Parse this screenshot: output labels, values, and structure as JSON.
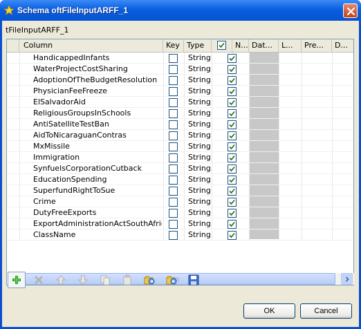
{
  "window": {
    "title": "Schema oftFileInputARFF_1",
    "icon": "star-icon",
    "close_icon": "close-icon"
  },
  "schema_label": "tFileInputARFF_1",
  "table": {
    "columns": [
      "Column",
      "Key",
      "Type",
      "",
      "N...",
      "Dat...",
      "L...",
      "Pre...",
      "D..."
    ],
    "rows": [
      {
        "name": "HandicappedInfants",
        "key": false,
        "type": "String",
        "nullable": true
      },
      {
        "name": "WaterProjectCostSharing",
        "key": false,
        "type": "String",
        "nullable": true
      },
      {
        "name": "AdoptionOfTheBudgetResolution",
        "key": false,
        "type": "String",
        "nullable": true
      },
      {
        "name": "PhysicianFeeFreeze",
        "key": false,
        "type": "String",
        "nullable": true
      },
      {
        "name": "ElSalvadorAid",
        "key": false,
        "type": "String",
        "nullable": true
      },
      {
        "name": "ReligiousGroupsInSchools",
        "key": false,
        "type": "String",
        "nullable": true
      },
      {
        "name": "AntiSatelliteTestBan",
        "key": false,
        "type": "String",
        "nullable": true
      },
      {
        "name": "AidToNicaraguanContras",
        "key": false,
        "type": "String",
        "nullable": true
      },
      {
        "name": "MxMissile",
        "key": false,
        "type": "String",
        "nullable": true
      },
      {
        "name": "Immigration",
        "key": false,
        "type": "String",
        "nullable": true
      },
      {
        "name": "SynfuelsCorporationCutback",
        "key": false,
        "type": "String",
        "nullable": true
      },
      {
        "name": "EducationSpending",
        "key": false,
        "type": "String",
        "nullable": true
      },
      {
        "name": "SuperfundRightToSue",
        "key": false,
        "type": "String",
        "nullable": true
      },
      {
        "name": "Crime",
        "key": false,
        "type": "String",
        "nullable": true
      },
      {
        "name": "DutyFreeExports",
        "key": false,
        "type": "String",
        "nullable": true
      },
      {
        "name": "ExportAdministrationActSouthAfrica",
        "key": false,
        "type": "String",
        "nullable": true
      },
      {
        "name": "ClassName",
        "key": false,
        "type": "String",
        "nullable": true
      }
    ]
  },
  "toolbar": {
    "buttons": [
      {
        "icon": "add-icon",
        "enabled": true
      },
      {
        "icon": "remove-icon",
        "enabled": false
      },
      {
        "icon": "move-up-icon",
        "enabled": false
      },
      {
        "icon": "move-down-icon",
        "enabled": false
      },
      {
        "icon": "copy-icon",
        "enabled": false
      },
      {
        "icon": "paste-icon",
        "enabled": false
      },
      {
        "icon": "import-icon",
        "enabled": true
      },
      {
        "icon": "export-icon",
        "enabled": true
      },
      {
        "icon": "save-icon",
        "enabled": true
      }
    ]
  },
  "buttons": {
    "ok_label": "OK",
    "cancel_label": "Cancel"
  }
}
